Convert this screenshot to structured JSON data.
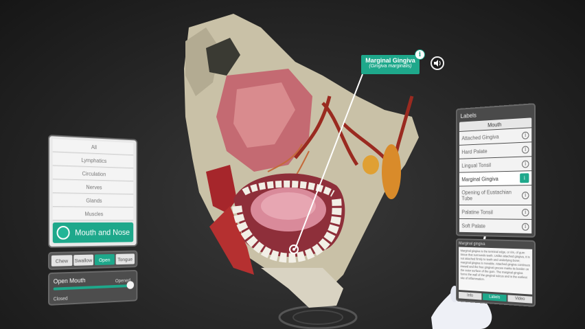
{
  "left_panel": {
    "systems": [
      "All",
      "Lymphatics",
      "Circulation",
      "Nerves",
      "Glands",
      "Muscles"
    ],
    "selected_system": "Mouth and Nose",
    "actions": [
      "Chew",
      "Swallow",
      "Open",
      "Tongue"
    ],
    "active_action": "Open",
    "slider": {
      "title": "Open Mouth",
      "min_label": "Closed",
      "max_label": "Opened",
      "value": 1.0
    }
  },
  "labels_panel": {
    "title": "Labels",
    "group": "Mouth",
    "items": [
      "Attached Gingiva",
      "Hard Palate",
      "Lingual Tonsil",
      "Marginal Gingiva",
      "Opening of Eustachian Tube",
      "Palatine Tonsil",
      "Soft Palate"
    ],
    "selected": "Marginal Gingiva"
  },
  "description": {
    "title": "Marginal gingiva",
    "text": "Marginal gingiva is the terminal edge, or rim, of gum tissue that surrounds teeth. Unlike attached gingiva, it is not attached firmly to teeth and underlying bone; marginal gingiva is movable. Attached gingiva continues inward and the free gingival groove marks its border on the outer surface of the gum. The marginal gingiva forms the wall of the gingival sulcus and is the earliest site of inflammation.",
    "tabs": [
      "Info",
      "Labels",
      "Video"
    ],
    "active_tab": "Labels"
  },
  "callout": {
    "name": "Marginal Gingiva",
    "latin": "(Gingiva marginalis)"
  },
  "colors": {
    "accent": "#1ea88b"
  }
}
